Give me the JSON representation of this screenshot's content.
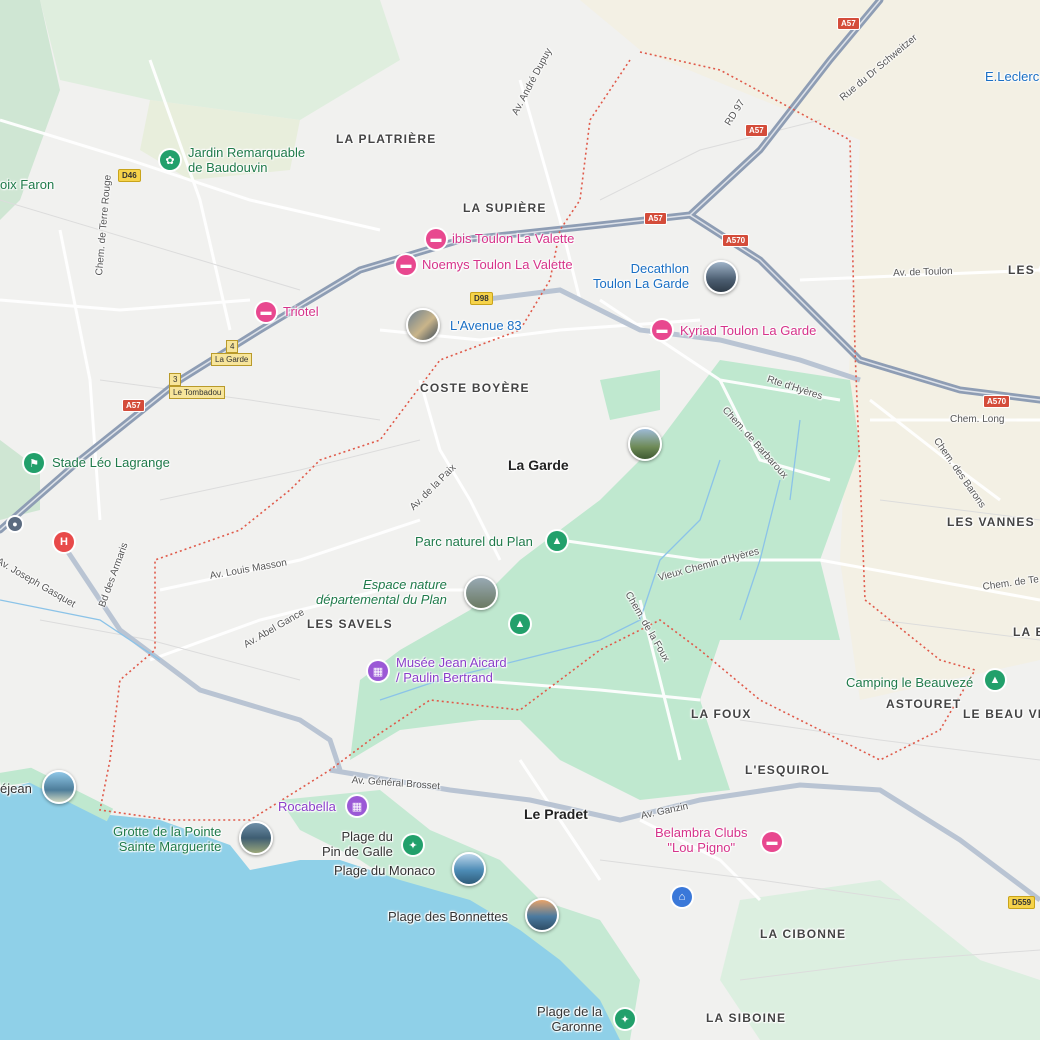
{
  "districts": [
    "LA PLATRIÈRE",
    "LA SUPIÈRE",
    "COSTE BOYÈRE",
    "LES SAVELS",
    "LES VANNES",
    "ASTOURET",
    "LE BEAU VEZ",
    "LA FOUX",
    "L'ESQUIROL",
    "LA CIBONNE",
    "LA SIBOINE",
    "LES CY",
    "LA B"
  ],
  "towns": [
    "La Garde",
    "Le Pradet"
  ],
  "streets": [
    "Av. André Dupuy",
    "RD 97",
    "Rue du Dr Schweitzer",
    "Chem. de Terre Rouge",
    "Av. de Toulon",
    "Rte d'Hyères",
    "Chem. de Barbaroux",
    "Chem. Long",
    "Chem. des Barons",
    "Av. de la Paix",
    "Av. Louis Masson",
    "Av. Abel Gance",
    "Vieux Chemin d'Hyères",
    "Chem. de la Foux",
    "Av. Général Brosset",
    "Av. Ganzin",
    "Bd des Armaris",
    "Av. Joseph Gasquet",
    "Chem. de Te"
  ],
  "pois": {
    "jardin": "Jardin Remarquable\nde Baudouvin",
    "faron": "oix Faron",
    "ibis": "ibis Toulon La Valette",
    "noemys": "Noemys Toulon La Valette",
    "triotel": "Triotel",
    "avenue83": "L'Avenue 83",
    "decathlon": "Decathlon\nToulon La Garde",
    "kyriad": "Kyriad Toulon La Garde",
    "leclerc": "E.Leclerc",
    "stade": "Stade Léo Lagrange",
    "parc": "Parc naturel du Plan",
    "espace": "Espace nature\ndépartemental du Plan",
    "musee": "Musée Jean Aicard\n/ Paulin Bertrand",
    "camping": "Camping le Beauvezé",
    "rocabella": "Rocabella",
    "grotte": "Grotte de la Pointe\nSainte Marguerite",
    "pin_galle": "Plage du\nPin de Galle",
    "monaco": "Plage du Monaco",
    "bonnettes": "Plage des Bonnettes",
    "belambra": "Belambra Clubs\n\"Lou Pigno\"",
    "garonne": "Plage de la\nGaronne",
    "dejean": "éjean"
  },
  "shields": {
    "a57": "A57",
    "a570": "A570",
    "d46": "D46",
    "d98": "D98",
    "d559": "D559"
  },
  "exits": [
    "4",
    "La Garde",
    "3",
    "Le Tombadou"
  ],
  "icons": [
    "hotel-icon",
    "park-icon",
    "museum-icon",
    "beach-icon",
    "hospital-icon",
    "home-icon",
    "photo-thumbnail",
    "jardin-icon",
    "stade-icon",
    "camping-icon"
  ],
  "colors": {
    "water": "#8fd0e8",
    "park": "#bfe8cf",
    "urban": "#eeeeee",
    "highway": "#8e9db4",
    "boundary": "#e05a4a",
    "field": "#f3efe0"
  }
}
